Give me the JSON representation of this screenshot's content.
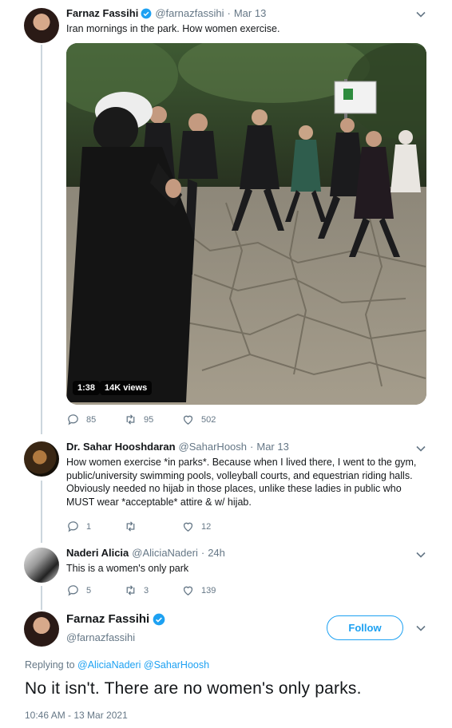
{
  "tweets": [
    {
      "name": "Farnaz Fassihi",
      "handle": "@farnazfassihi",
      "date": "Mar 13",
      "text": "Iran mornings in the park. How women exercise.",
      "media": {
        "duration": "1:38",
        "views": "14K views"
      },
      "replies": "85",
      "retweets": "95",
      "likes": "502"
    },
    {
      "name": "Dr. Sahar Hooshdaran",
      "handle": "@SaharHoosh",
      "date": "Mar 13",
      "text": "How women exercise *in parks*. Because when I lived there, I went to the gym, public/university swimming pools, volleyball courts, and equestrian riding halls. Obviously needed no hijab in those places, unlike these ladies in public who MUST wear *acceptable* attire & w/ hijab.",
      "replies": "1",
      "retweets": "",
      "likes": "12"
    },
    {
      "name": "Naderi Alicia",
      "handle": "@AliciaNaderi",
      "date": "24h",
      "text": "This is a women's only park",
      "replies": "5",
      "retweets": "3",
      "likes": "139"
    }
  ],
  "focused": {
    "name": "Farnaz Fassihi",
    "handle": "@farnazfassihi",
    "follow_label": "Follow",
    "replying_prefix": "Replying to",
    "replying_to": "@AliciaNaderi @SaharHoosh",
    "text": "No it isn't. There are no women's only parks.",
    "timestamp": "10:46 AM - 13 Mar 2021"
  },
  "separator": "·",
  "colors": {
    "accent": "#1da1f2",
    "secondary_text": "#657786",
    "thread_line": "#ccd6dd"
  },
  "icons": [
    "verified-badge-icon",
    "chevron-down-icon",
    "reply-icon",
    "retweet-icon",
    "like-icon"
  ]
}
